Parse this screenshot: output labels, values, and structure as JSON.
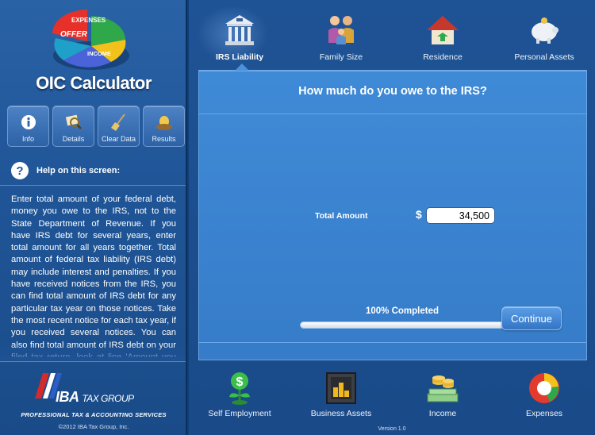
{
  "sidebar": {
    "logo_words": [
      "EXPENSES",
      "OFFER",
      "INCOME"
    ],
    "app_title": "OIC Calculator",
    "tools": [
      {
        "label": "Info",
        "icon": "info-icon"
      },
      {
        "label": "Details",
        "icon": "magnifier-icon"
      },
      {
        "label": "Clear Data",
        "icon": "broom-icon"
      },
      {
        "label": "Results",
        "icon": "nest-egg-icon"
      }
    ],
    "help_title": "Help on this screen:",
    "help_text": "Enter total amount of your federal debt, money you owe to the IRS, not to the State Department of Revenue. If you have IRS debt for several years, enter total amount for all years together. Total amount of federal tax liability (IRS debt) may include interest and penalties. If you have received notices from the IRS, you can find total amount of IRS debt for any particular tax year on those notices. Take the most recent notice for each tax year, if you received several notices. You can also find total amount of IRS debt on your filed tax return, look at line 'Amount you owe' for each tax year.",
    "brand_name": "IBA",
    "brand_suffix": "TAX GROUP",
    "brand_tagline": "PROFESSIONAL TAX & ACCOUNTING SERVICES",
    "copyright": "©2012 IBA Tax Group, Inc."
  },
  "top_tabs": [
    {
      "label": "IRS Liability",
      "icon": "bank-building-icon",
      "active": true
    },
    {
      "label": "Family Size",
      "icon": "family-icon",
      "active": false
    },
    {
      "label": "Residence",
      "icon": "house-icon",
      "active": false
    },
    {
      "label": "Personal Assets",
      "icon": "piggy-bank-icon",
      "active": false
    }
  ],
  "bottom_tabs": [
    {
      "label": "Self Employment",
      "icon": "money-plant-icon"
    },
    {
      "label": "Business Assets",
      "icon": "safe-icon"
    },
    {
      "label": "Income",
      "icon": "cash-stack-icon"
    },
    {
      "label": "Expenses",
      "icon": "pie-chart-icon"
    }
  ],
  "panel": {
    "question": "How much do you owe to the IRS?",
    "amount_label": "Total Amount",
    "currency": "$",
    "amount_value": "34,500",
    "progress_label": "100% Completed",
    "progress_fraction": 1.0,
    "continue_label": "Continue"
  },
  "version": "Version 1.0",
  "colors": {
    "accent": "#3f8ad6",
    "sidebar": "#1f5597",
    "background": "#1a4a88"
  }
}
